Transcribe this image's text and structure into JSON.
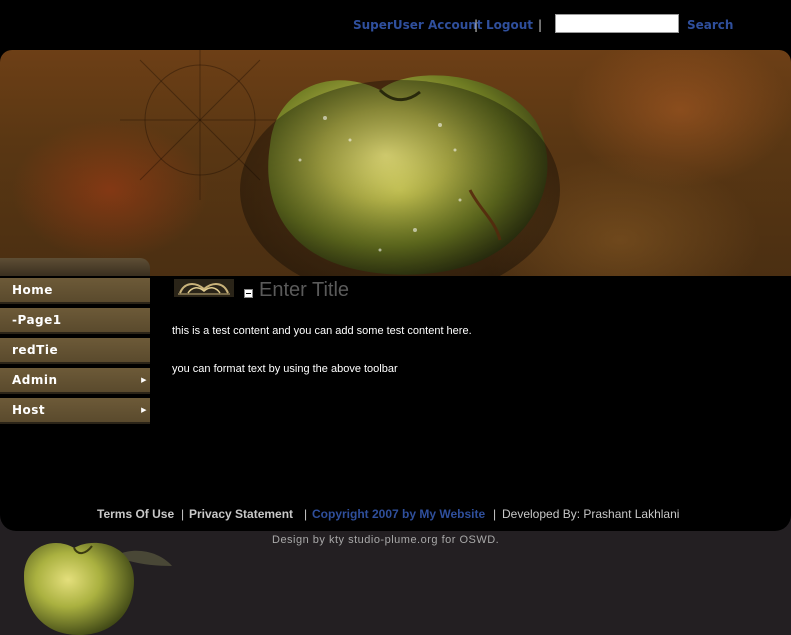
{
  "header": {
    "user_link": "SuperUser Account",
    "separator": "|",
    "logout_link": "Logout",
    "search": {
      "value": "",
      "button_label": "Search"
    }
  },
  "nav": {
    "items": [
      {
        "label": "Home",
        "has_submenu": false
      },
      {
        "label": "-Page1",
        "has_submenu": false
      },
      {
        "label": "redTie",
        "has_submenu": false
      },
      {
        "label": "Admin",
        "has_submenu": true
      },
      {
        "label": "Host",
        "has_submenu": true
      }
    ],
    "submenu_glyph": "▶"
  },
  "module": {
    "title": "Enter Title",
    "paragraphs": [
      "this is a test content and you can add some test content here.",
      "you can format text by using the above toolbar"
    ]
  },
  "footer": {
    "terms": "Terms Of Use",
    "privacy": "Privacy Statement",
    "copyright": "Copyright 2007 by My Website",
    "developer": "Developed By: Prashant Lakhlani",
    "design_credit": "Design by kty studio-plume.org for OSWD."
  },
  "colors": {
    "link_blue": "#2f4f9c",
    "nav_bg": "#6d5a38",
    "page_bg": "#000000",
    "outer_bg": "#231f22"
  }
}
